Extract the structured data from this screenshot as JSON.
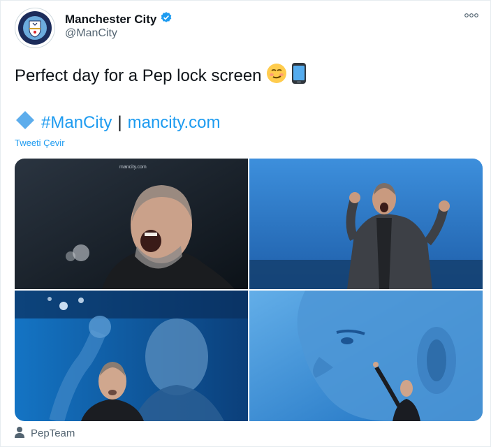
{
  "account": {
    "name": "Manchester City",
    "handle": "@ManCity",
    "crest_text": "MANCHESTER CITY"
  },
  "tweet": {
    "text": "Perfect day for a Pep lock screen",
    "hashtag": "#ManCity",
    "separator": "|",
    "link": "mancity.com",
    "translate_label": "Tweeti Çevir"
  },
  "media": {
    "watermark": "mancity.com",
    "images": [
      {
        "alt": "Pep Guardiola shouting, dark background"
      },
      {
        "alt": "Pep Guardiola celebrating with fists raised"
      },
      {
        "alt": "Pep Guardiola with fist raised, blue collage"
      },
      {
        "alt": "Pep Guardiola close-up profile with pointing figure"
      }
    ]
  },
  "footer": {
    "tagged": "PepTeam"
  },
  "colors": {
    "accent": "#1d9bf0",
    "text": "#0f1419",
    "muted": "#536471",
    "city_blue": "#6cabdd"
  }
}
